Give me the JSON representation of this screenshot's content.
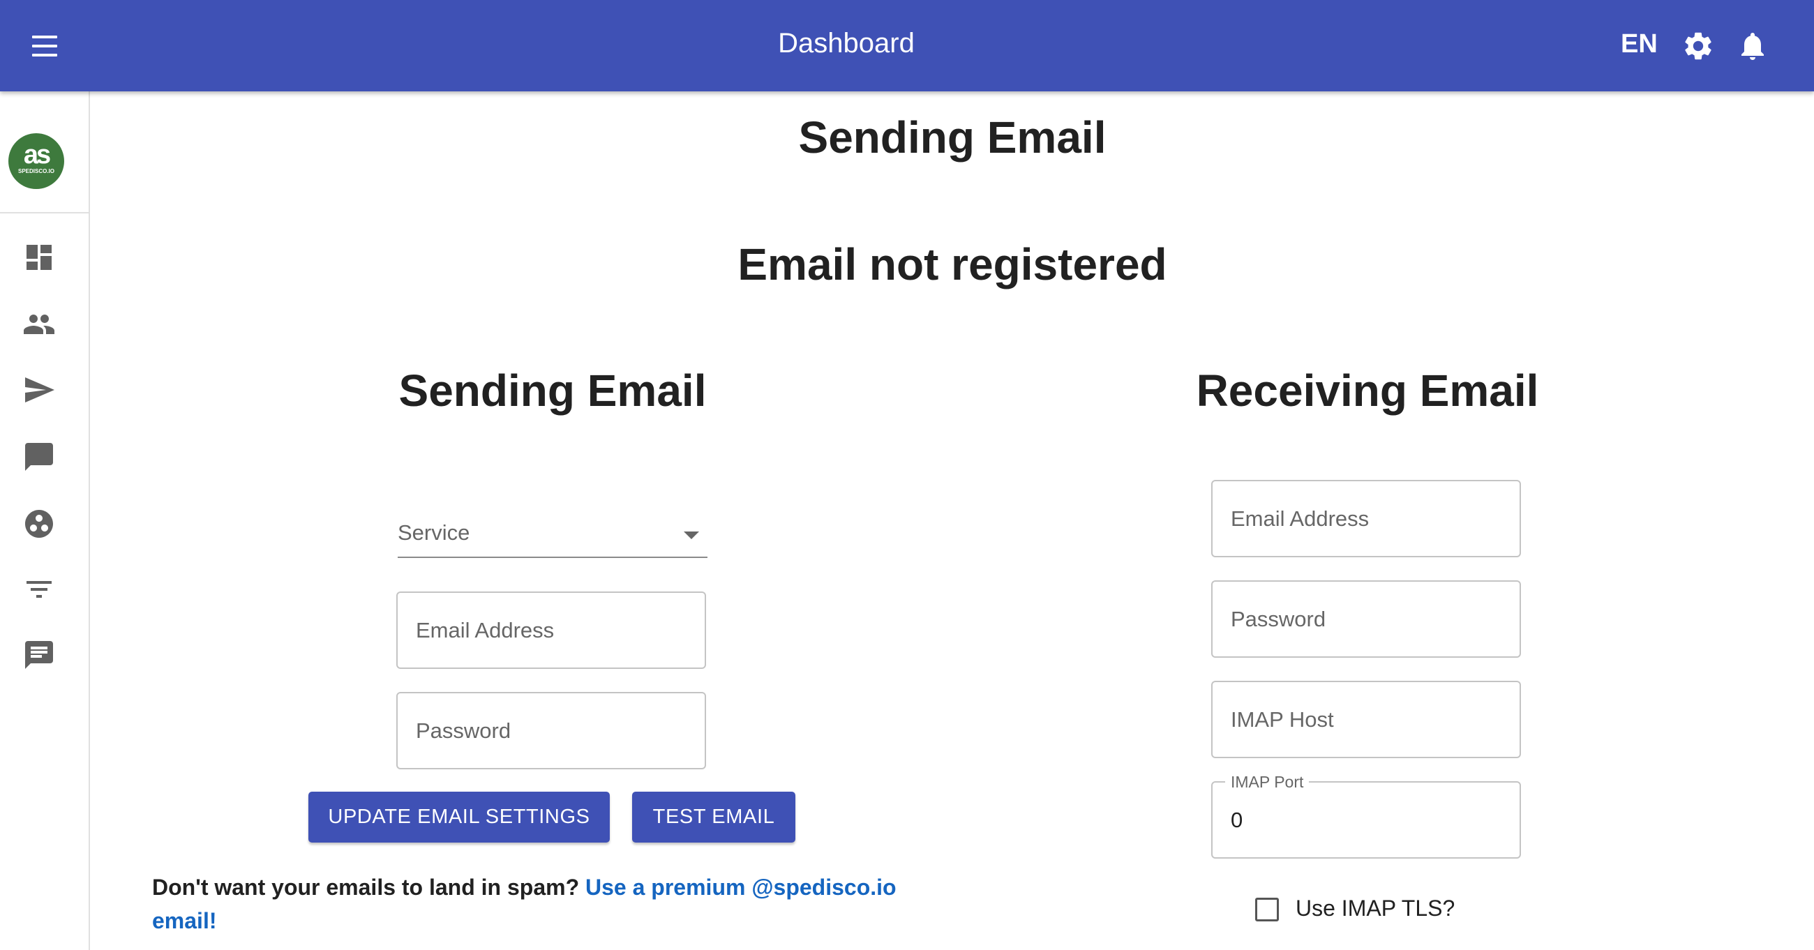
{
  "appbar": {
    "title": "Dashboard",
    "language": "EN",
    "icons": [
      "menu-icon",
      "gear-icon",
      "bell-icon"
    ],
    "color": "#3f51b5"
  },
  "sidebar": {
    "logo_text": "SPEDISCO.IO",
    "logo_color": "#3e7a3d",
    "items": [
      {
        "icon": "dashboard-icon"
      },
      {
        "icon": "people-icon"
      },
      {
        "icon": "send-icon"
      },
      {
        "icon": "chat-bubble-icon"
      },
      {
        "icon": "group-circle-icon"
      },
      {
        "icon": "filter-icon"
      },
      {
        "icon": "message-icon"
      }
    ]
  },
  "main": {
    "title": "Sending Email",
    "status": "Email not registered"
  },
  "sending": {
    "heading": "Sending Email",
    "service_label": "Service",
    "email_placeholder": "Email Address",
    "password_placeholder": "Password",
    "update_button": "UPDATE EMAIL SETTINGS",
    "test_button": "TEST EMAIL"
  },
  "receiving": {
    "heading": "Receiving Email",
    "email_placeholder": "Email Address",
    "password_placeholder": "Password",
    "imap_host_placeholder": "IMAP Host",
    "imap_port_label": "IMAP Port",
    "imap_port_value": "0",
    "tls_label": "Use IMAP TLS?",
    "tls_checked": false
  },
  "spam_notice": {
    "text": "Don't want your emails to land in spam? ",
    "link_text": "Use a premium @spedisco.io email!",
    "link_color": "#1565c0"
  }
}
